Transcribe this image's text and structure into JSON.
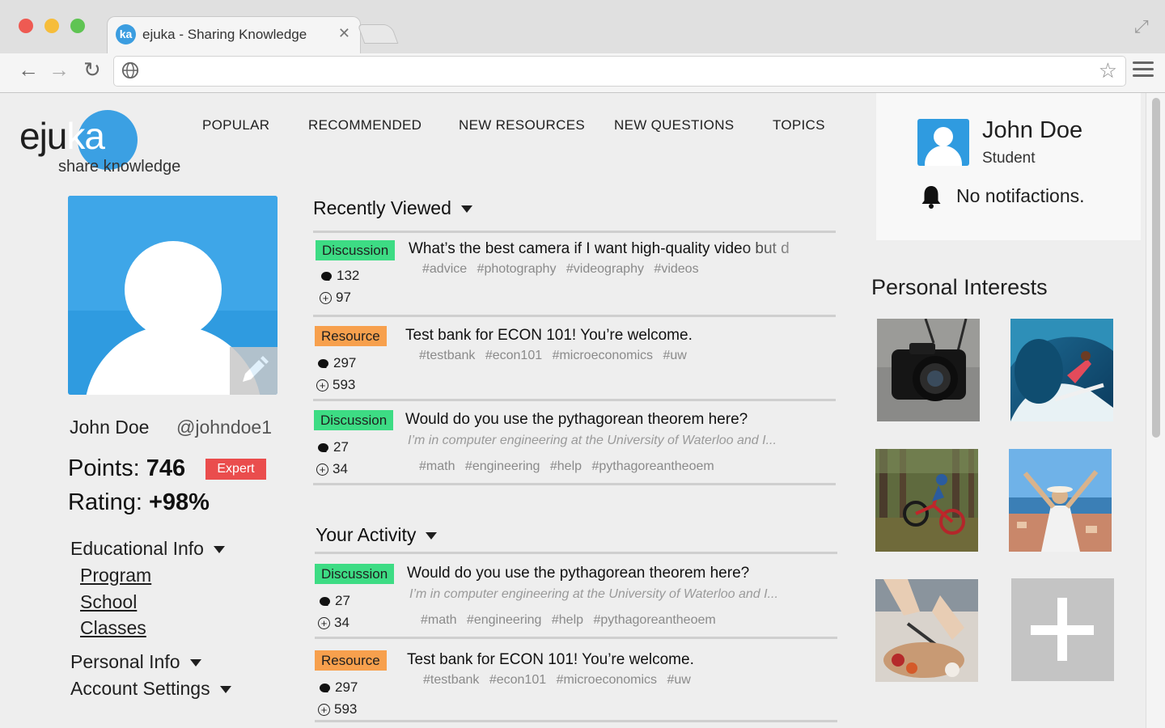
{
  "browser": {
    "tab_title": "ejuka - Sharing Knowledge",
    "tab_favicon": "ka",
    "close_glyph": "✕",
    "url": "",
    "colors": {
      "close": "#ee5a52",
      "minimize": "#f6bd3b",
      "maximize": "#5fc453"
    }
  },
  "logo": {
    "main_prefix": "eju",
    "main_suffix": "ka",
    "subtitle": "share knowledge",
    "color": "#3ba0e3"
  },
  "nav": [
    "POPULAR",
    "RECOMMENDED",
    "NEW RESOURCES",
    "NEW QUESTIONS",
    "TOPICS"
  ],
  "profile": {
    "name": "John Doe",
    "handle": "@johndoe1",
    "points_label": "Points:",
    "points": "746",
    "level": "Expert",
    "rating_label": "Rating:",
    "rating": "+98%",
    "sections": {
      "educational": "Educational Info",
      "educational_items": [
        "Program",
        "School",
        "Classes"
      ],
      "personal": "Personal Info",
      "account": "Account Settings"
    }
  },
  "recently_viewed": {
    "title": "Recently Viewed",
    "items": [
      {
        "type": "Discussion",
        "title": "What’s the best camera if I want high-quality video but d",
        "tags": "#advice #photography #videography #videos",
        "comments": "132",
        "score": "97"
      },
      {
        "type": "Resource",
        "title": "Test bank for ECON 101! You’re welcome.",
        "tags": "#testbank #econ101 #microeconomics #uw",
        "comments": "297",
        "score": "593"
      },
      {
        "type": "Discussion",
        "title": "Would do you use the pythagorean theorem here?",
        "snippet": "I’m in computer engineering at the University of Waterloo and I...",
        "tags": "#math #engineering #help #pythagoreantheoem",
        "comments": "27",
        "score": "34"
      }
    ]
  },
  "your_activity": {
    "title": "Your Activity",
    "items": [
      {
        "type": "Discussion",
        "title": "Would do you use the pythagorean theorem here?",
        "snippet": "I’m in computer engineering at the University of Waterloo and I...",
        "tags": "#math #engineering #help #pythagoreantheoem",
        "comments": "27",
        "score": "34"
      },
      {
        "type": "Resource",
        "title": "Test bank for ECON 101! You’re welcome.",
        "tags": "#testbank #econ101 #microeconomics #uw",
        "comments": "297",
        "score": "593"
      }
    ]
  },
  "user_card": {
    "name": "John Doe",
    "role": "Student",
    "notifications": "No notifactions."
  },
  "interests": {
    "title": "Personal Interests",
    "tiles": [
      "camera-photo",
      "surfing-photo",
      "mountain-biking-photo",
      "travel-photo",
      "cooking-photo",
      "add-interest-button"
    ]
  }
}
